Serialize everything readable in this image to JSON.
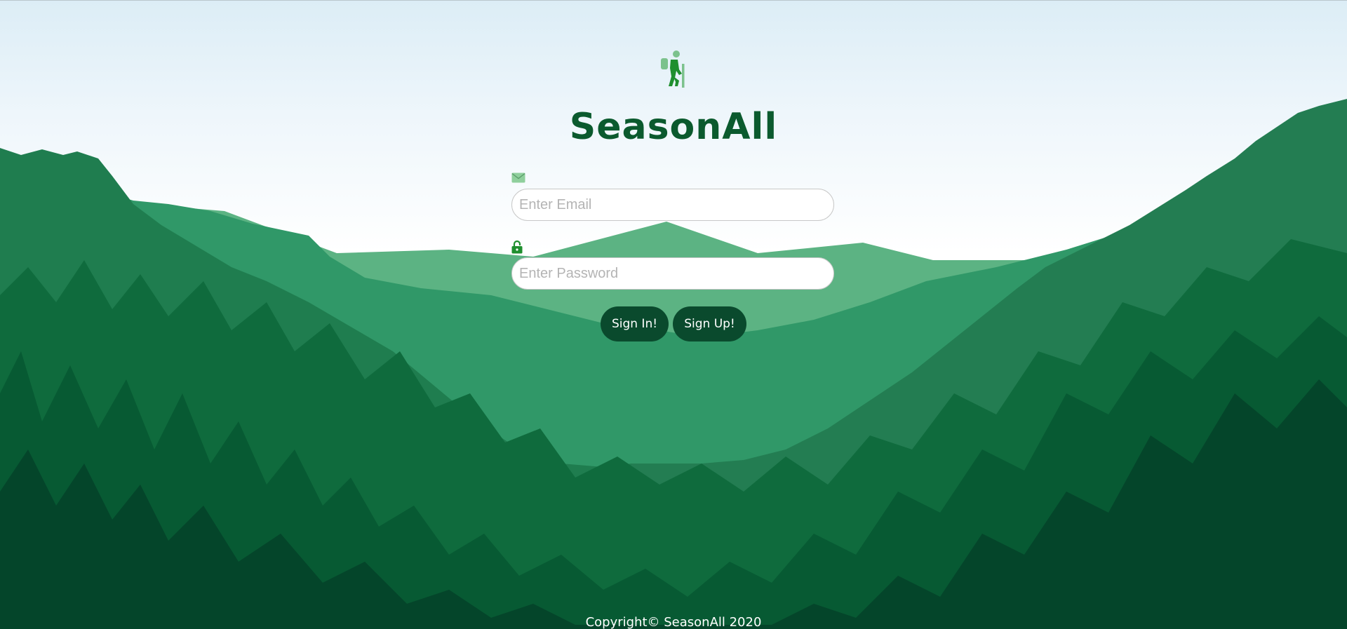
{
  "app": {
    "brand": "SeasonAll",
    "logo_icon": "hiker-icon"
  },
  "login": {
    "email_icon": "envelope-icon",
    "email_placeholder": "Enter Email",
    "email_value": "",
    "password_icon": "lock-icon",
    "password_placeholder": "Enter Password",
    "password_value": "",
    "signin_label": "Sign In!",
    "signup_label": "Sign Up!"
  },
  "footer": {
    "text": "Copyright© SeasonAll 2020"
  },
  "colors": {
    "brand_green": "#0b5a2e",
    "button_bg": "#0a4a2d",
    "icon_green": "#1f8f2e"
  }
}
